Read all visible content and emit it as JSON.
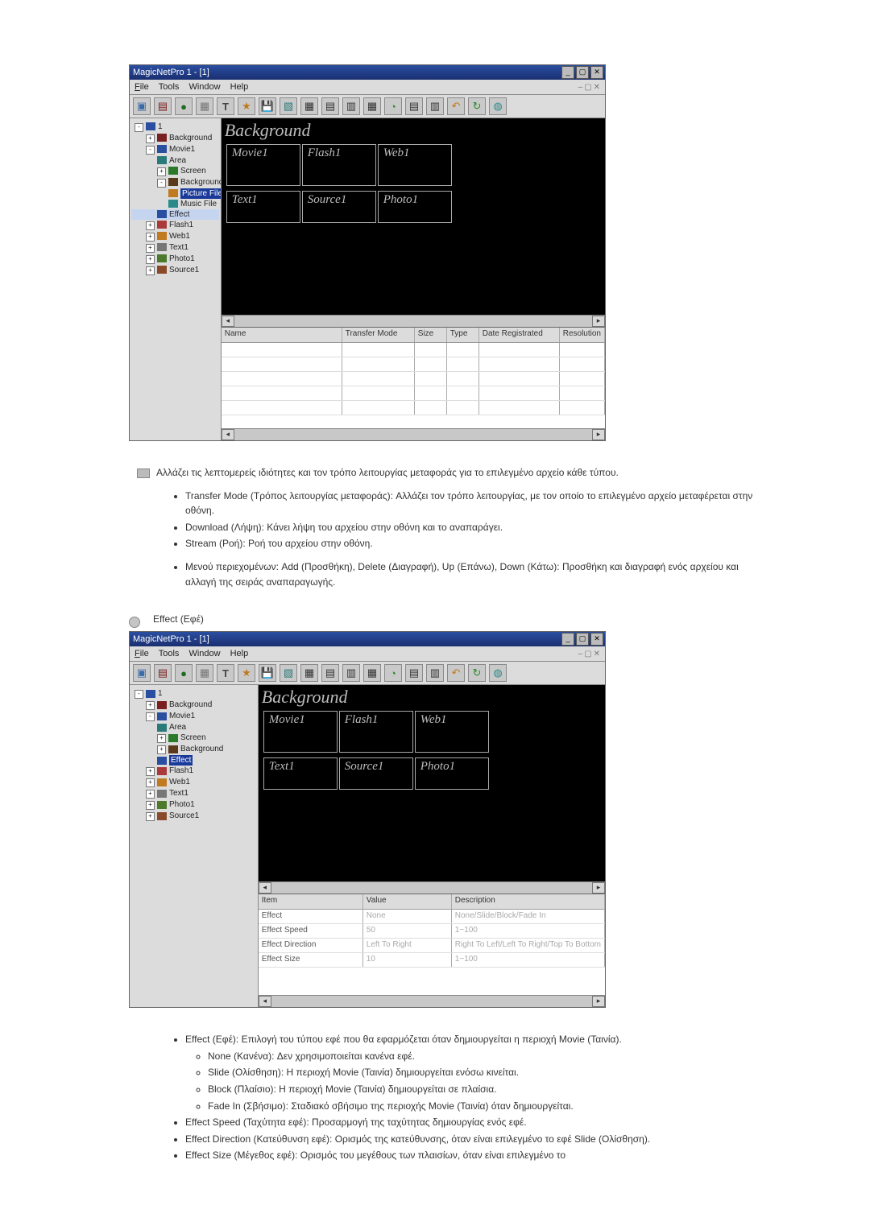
{
  "app": {
    "title": "MagicNetPro 1 - [1]",
    "menu": {
      "file": "File",
      "tools": "Tools",
      "window": "Window",
      "help": "Help"
    }
  },
  "tree1": {
    "root": "1",
    "background": "Background",
    "movie1": "Movie1",
    "area": "Area",
    "screen": "Screen",
    "background2": "Background",
    "picture_file": "Picture File",
    "music_file": "Music File",
    "effect": "Effect",
    "flash1": "Flash1",
    "web1": "Web1",
    "text1": "Text1",
    "photo1": "Photo1",
    "source1": "Source1"
  },
  "tree2": {
    "root": "1",
    "background": "Background",
    "movie1": "Movie1",
    "area": "Area",
    "screen": "Screen",
    "background2": "Background",
    "effect": "Effect",
    "flash1": "Flash1",
    "web1": "Web1",
    "text1": "Text1",
    "photo1": "Photo1",
    "source1": "Source1"
  },
  "stage": {
    "bg": "Background",
    "movie1": "Movie1",
    "flash1": "Flash1",
    "web1": "Web1",
    "text1": "Text1",
    "source1": "Source1",
    "photo1": "Photo1"
  },
  "grid1": {
    "cols": {
      "name": "Name",
      "transfer": "Transfer Mode",
      "size": "Size",
      "type": "Type",
      "date": "Date Registrated",
      "res": "Resolution"
    }
  },
  "grid2": {
    "cols": {
      "item": "Item",
      "value": "Value",
      "desc": "Description"
    },
    "rows": [
      {
        "item": "Effect",
        "value": "None",
        "desc": "None/Slide/Block/Fade In"
      },
      {
        "item": "Effect Speed",
        "value": "50",
        "desc": "1~100"
      },
      {
        "item": "Effect Direction",
        "value": "Left To Right",
        "desc": "Right To Left/Left To Right/Top To Bottom"
      },
      {
        "item": "Effect Size",
        "value": "10",
        "desc": "1~100"
      }
    ]
  },
  "p1": "Αλλάζει τις λεπτομερείς ιδιότητες και τον τρόπο λειτουργίας μεταφοράς για το επιλεγμένο αρχείο κάθε τύπου.",
  "b1": {
    "transfer": "Transfer Mode (Τρόπος λειτουργίας μεταφοράς): Αλλάζει τον τρόπο λειτουργίας, με τον οποίο το επιλεγμένο αρχείο μεταφέρεται στην οθόνη.",
    "download": "Download (Λήψη): Κάνει λήψη του αρχείου στην οθόνη και το αναπαράγει.",
    "stream": "Stream (Ροή): Ροή του αρχείου στην οθόνη.",
    "context": "Μενού περιεχομένων: Add (Προσθήκη), Delete (Διαγραφή), Up (Επάνω), Down (Κάτω): Προσθήκη και διαγραφή ενός αρχείου και αλλαγή της σειράς αναπαραγωγής."
  },
  "heading_effect": "Effect (Εφέ)",
  "b2": {
    "effect": "Effect (Εφέ): Επιλογή του τύπου εφέ που θα εφαρμόζεται όταν δημιουργείται η περιοχή Movie (Ταινία).",
    "none": "None (Κανένα): Δεν χρησιμοποιείται κανένα εφέ.",
    "slide": "Slide (Ολίσθηση): Η περιοχή Movie (Ταινία) δημιουργείται ενόσω κινείται.",
    "block": "Block (Πλαίσιο): Η περιοχή Movie (Ταινία) δημιουργείται σε πλαίσια.",
    "fadein": "Fade In (Σβήσιμο): Σταδιακό σβήσιμο της περιοχής Movie (Ταινία) όταν δημιουργείται.",
    "speed": "Effect Speed (Ταχύτητα εφέ): Προσαρμογή της ταχύτητας δημιουργίας ενός εφέ.",
    "direction": "Effect Direction (Κατεύθυνση εφέ): Ορισμός της κατεύθυνσης, όταν είναι επιλεγμένο το εφέ Slide (Ολίσθηση).",
    "size": "Effect Size (Μέγεθος εφέ): Ορισμός του μεγέθους των πλαισίων, όταν είναι επιλεγμένο το"
  }
}
